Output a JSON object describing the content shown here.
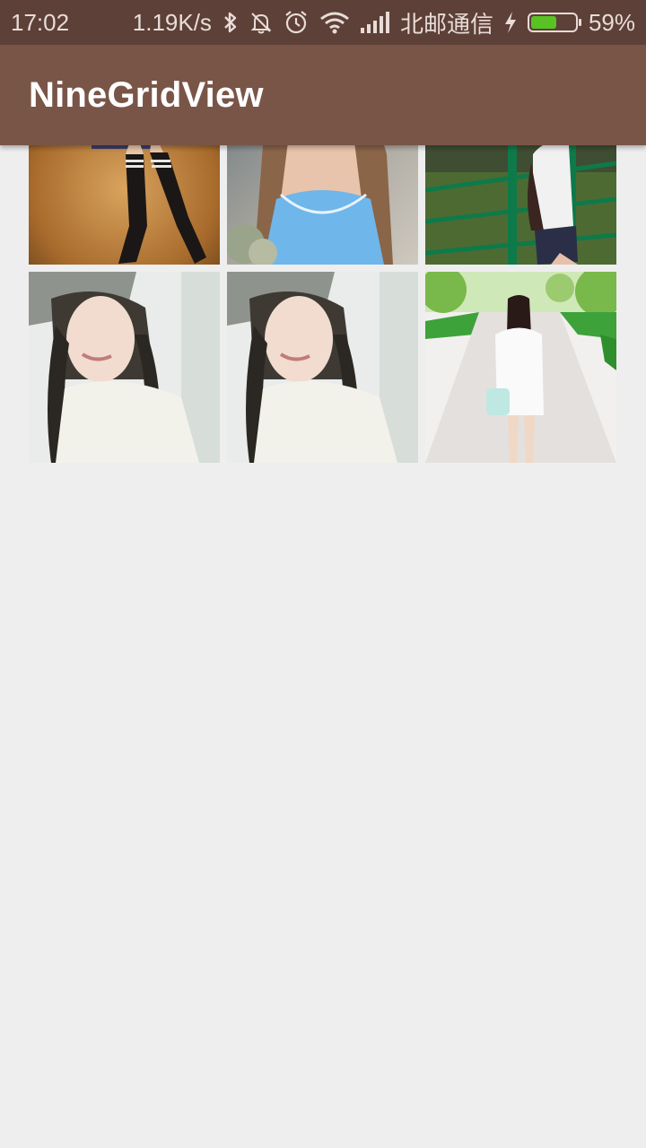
{
  "status_bar": {
    "time": "17:02",
    "net_speed": "1.19K/s",
    "carrier": "北邮通信",
    "battery_percent": "59%",
    "battery_level": 0.59,
    "battery_color": "#58c322",
    "icons": [
      "bluetooth-icon",
      "notifications-off-icon",
      "alarm-icon",
      "wifi-icon",
      "cellular-signal-icon",
      "charging-bolt-icon",
      "battery-icon"
    ]
  },
  "app_bar": {
    "title": "NineGridView",
    "color": "#795548",
    "status_color": "#5d4037"
  },
  "grid": {
    "images": [
      {
        "name": "grid-image-legs-stockings"
      },
      {
        "name": "grid-image-blue-dress"
      },
      {
        "name": "grid-image-green-railing"
      },
      {
        "name": "grid-image-braids-hat"
      },
      {
        "name": "grid-image-braids-hat-2"
      },
      {
        "name": "grid-image-walkway"
      }
    ]
  }
}
